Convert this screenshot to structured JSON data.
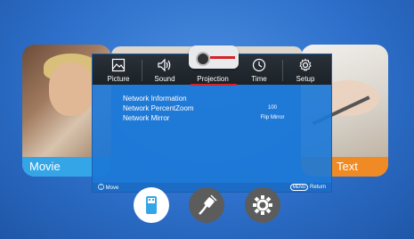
{
  "cards": {
    "left_label": "Movie",
    "right_label": "Text"
  },
  "tabs": [
    {
      "label": "Picture",
      "icon": "picture-icon"
    },
    {
      "label": "Sound",
      "icon": "sound-icon"
    },
    {
      "label": "Projection",
      "icon": "projector-icon",
      "selected": true
    },
    {
      "label": "Time",
      "icon": "clock-icon"
    },
    {
      "label": "Setup",
      "icon": "gear-icon"
    }
  ],
  "settings": [
    {
      "label": "Network Information",
      "value": ""
    },
    {
      "label": "Network PercentZoom",
      "value": "100"
    },
    {
      "label": "Network Mirror",
      "value": "Flip Mirror"
    }
  ],
  "footer": {
    "move": "Move",
    "menu_badge": "MENU",
    "return": "Return"
  },
  "dock": [
    "usb-icon",
    "cable-icon",
    "settings-gear-icon"
  ],
  "colors": {
    "background": "#2d6fca",
    "menu_panel": "#1c78d7",
    "tab_bar": "#22292f",
    "selected_underline": "#d8222a",
    "movie_caption": "#34a6e8",
    "text_caption": "#f08a24"
  }
}
